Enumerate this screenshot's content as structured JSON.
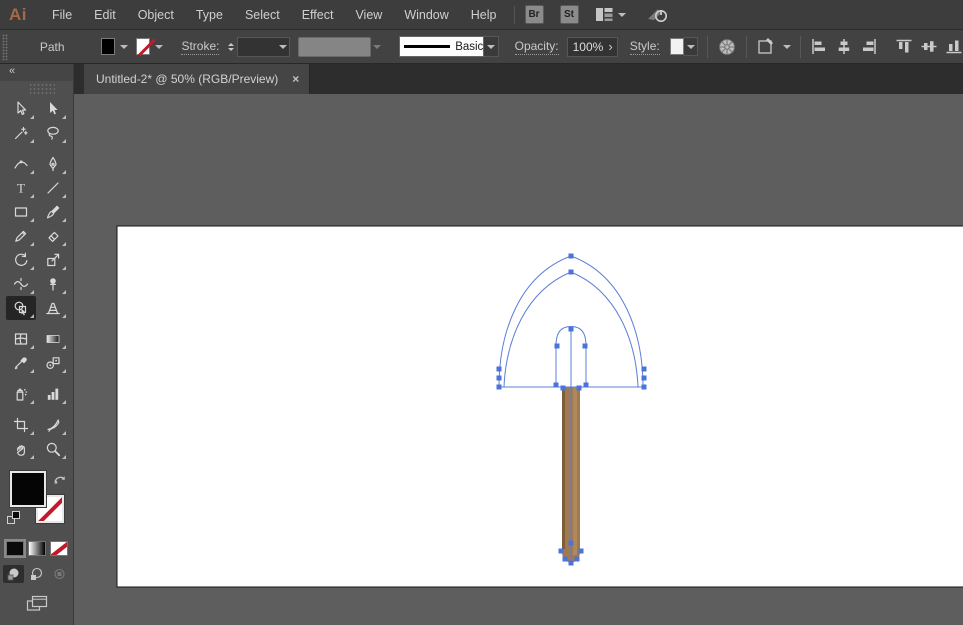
{
  "menu_bar": {
    "logo": "Ai",
    "items": [
      "File",
      "Edit",
      "Object",
      "Type",
      "Select",
      "Effect",
      "View",
      "Window",
      "Help"
    ],
    "bridge_button": "Br",
    "stock_button": "St"
  },
  "control_bar": {
    "selection_label": "Path",
    "stroke_label": "Stroke:",
    "brush_value": "Basic",
    "opacity_label": "Opacity:",
    "opacity_value": "100%",
    "opacity_arrow": "›",
    "style_label": "Style:"
  },
  "tab_bar": {
    "active_tab": "Untitled-2* @ 50% (RGB/Preview)",
    "close_glyph": "×"
  },
  "toolbar": {
    "collapse_glyph": "«",
    "active_tool": "shape-builder",
    "tools": [
      "selection",
      "direct-selection",
      "magic-wand",
      "lasso",
      "curvature",
      "pen",
      "type",
      "line-segment",
      "rectangle",
      "paintbrush",
      "shaper",
      "eraser",
      "rotate",
      "scale",
      "width",
      "puppet-warp",
      "shape-builder",
      "perspective-grid",
      "mesh",
      "gradient",
      "eyedropper",
      "blend",
      "symbol-sprayer",
      "column-graph",
      "artboard",
      "slice",
      "hand",
      "zoom"
    ],
    "type_tool_glyph": "T"
  },
  "icons": {
    "workspace": "workspace-switcher-icon",
    "gpu": "gpu-performance-icon",
    "recolor": "recolor-artwork-icon",
    "align": [
      "horizontal-align-left",
      "horizontal-align-center",
      "horizontal-align-right",
      "vertical-align-top",
      "vertical-align-center",
      "vertical-align-bottom"
    ]
  },
  "colors": {
    "accent_selection": "#4a74d9",
    "selection_stroke": "#5d7fd4",
    "blade_outer_fill": "#e7e7e7",
    "blade_inner_fill": "#f2f2f2",
    "socket_black": "#0c0c10",
    "handle_brown": "#a1794e",
    "handle_brown_dark": "#7e5d3b",
    "artboard_white": "#ffffff",
    "pasteboard_gray": "#5e5e5e"
  }
}
